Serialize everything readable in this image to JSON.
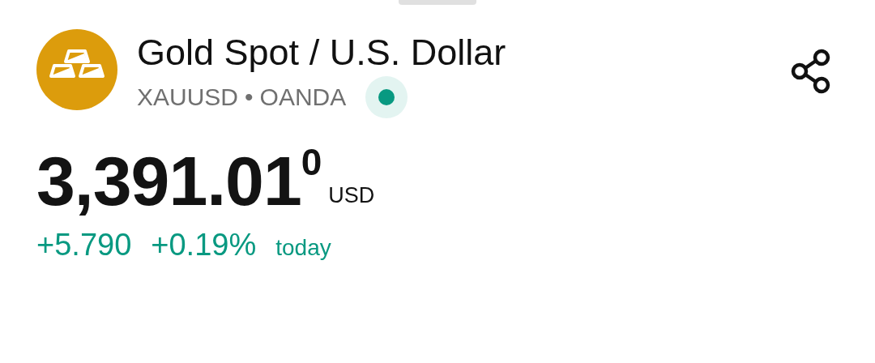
{
  "header": {
    "title": "Gold Spot / U.S. Dollar",
    "symbol": "XAUUSD",
    "separator": "•",
    "exchange": "OANDA",
    "market_open": true
  },
  "quote": {
    "price": "3,391.01",
    "price_extra_digit": "0",
    "currency": "USD",
    "change": "+5.790",
    "change_percent": "+0.19%",
    "period": "today",
    "positive": true
  }
}
